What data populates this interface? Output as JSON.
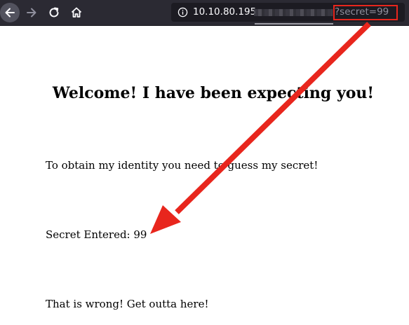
{
  "browser": {
    "url_host": "10.10.80.195",
    "url_query": "?secret=99",
    "icons": {
      "back": "arrow-left-icon",
      "forward": "arrow-right-icon",
      "reload": "reload-icon",
      "home": "home-icon",
      "info": "info-icon"
    }
  },
  "page": {
    "heading": "Welcome! I have been expecting you!",
    "intro": "To obtain my identity you need to guess my secret!",
    "secret_label": "Secret Entered: 99",
    "result": "That is wrong! Get outta here!"
  },
  "annotation": {
    "color": "#e8261d",
    "arrow_icon": "red-arrow-icon"
  }
}
